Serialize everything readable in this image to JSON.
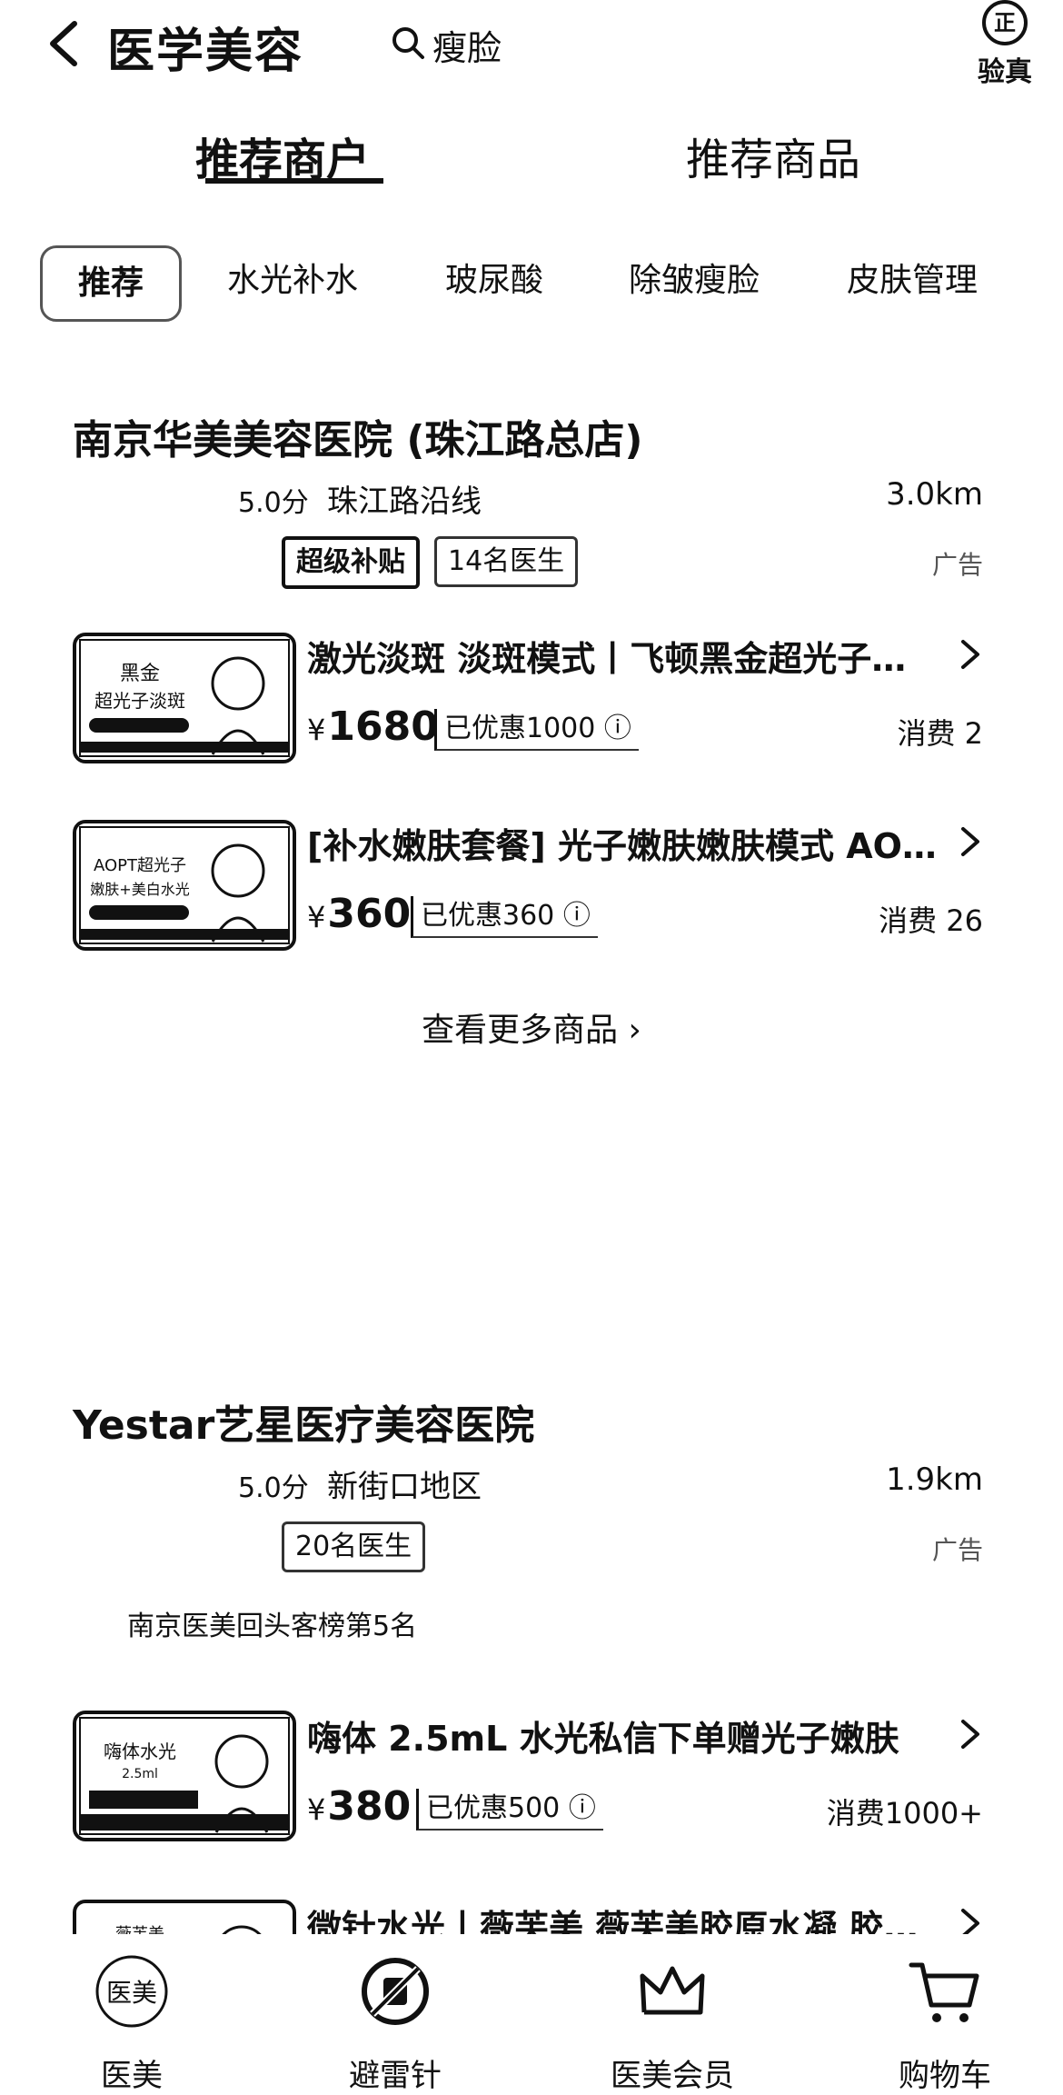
{
  "header": {
    "title": "医学美容",
    "search_text": "瘦脸",
    "verify_badge": "正",
    "verify_label": "验真"
  },
  "main_tabs": [
    {
      "label": "推荐商户",
      "active": true
    },
    {
      "label": "推荐商品",
      "active": false
    }
  ],
  "categories": [
    {
      "label": "推荐",
      "active": true
    },
    {
      "label": "水光补水",
      "active": false
    },
    {
      "label": "玻尿酸",
      "active": false
    },
    {
      "label": "除皱瘦脸",
      "active": false
    },
    {
      "label": "皮肤管理",
      "active": false
    }
  ],
  "merchants": [
    {
      "name": "南京华美美容医院 (珠江路总店)",
      "rating": "5.0分",
      "area": "珠江路沿线",
      "distance": "3.0km",
      "tags": [
        "超级补贴",
        "14名医生"
      ],
      "ad_label": "广告",
      "products": [
        {
          "title": "激光淡斑 淡斑模式丨飞顿黑金超光子…",
          "currency": "¥",
          "price": "1680",
          "discount": "已优惠1000",
          "sales": "消费 2",
          "thumb_lines": [
            "黑金",
            "超光子淡斑"
          ]
        },
        {
          "title": "[补水嫩肤套餐] 光子嫩肤嫩肤模式 AO…",
          "currency": "¥",
          "price": "360",
          "discount": "已优惠360",
          "sales": "消费 26",
          "thumb_lines": [
            "AOPT超光子",
            "嫩肤+美白水光"
          ]
        }
      ],
      "more_label": "查看更多商品"
    },
    {
      "name": "Yestar艺星医疗美容医院",
      "rating": "5.0分",
      "area": "新街口地区",
      "distance": "1.9km",
      "tags": [
        "20名医生"
      ],
      "ad_label": "广告",
      "rank": "南京医美回头客榜第5名",
      "products": [
        {
          "title": "嗨体 2.5mL 水光私信下单赠光子嫩肤",
          "currency": "¥",
          "price": "380",
          "discount": "已优惠500",
          "sales": "消费1000+",
          "thumb_lines": [
            "嗨体水光",
            "2.5ml"
          ]
        },
        {
          "title": "微针水光丨薇芙美 薇芙美胶原水凝 胶…",
          "thumb_lines": [
            "薇芙美"
          ]
        }
      ]
    }
  ],
  "bottom_nav": [
    {
      "label": "医美",
      "icon": "yimei-badge-icon",
      "badge_text": "医美"
    },
    {
      "label": "避雷针",
      "icon": "no-needle-icon"
    },
    {
      "label": "医美会员",
      "icon": "crown-icon"
    },
    {
      "label": "购物车",
      "icon": "cart-icon"
    }
  ]
}
